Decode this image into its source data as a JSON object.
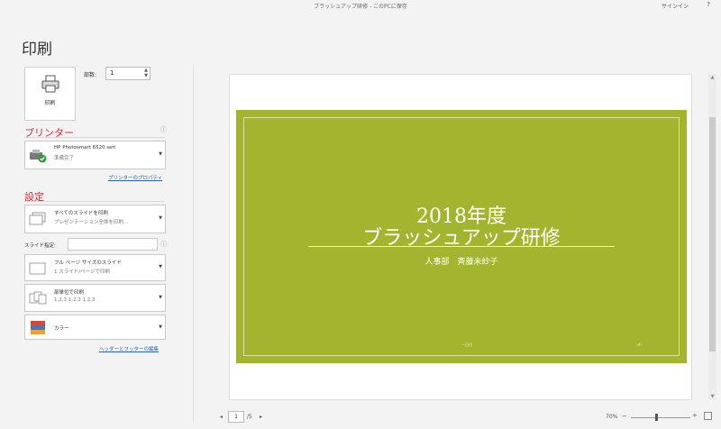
{
  "titlebar": {
    "doc_title": "ブラッシュアップ研修 - このPCに保存",
    "signin": "サインイン",
    "help": "?"
  },
  "page_title": "印刷",
  "print_button": {
    "label": "印刷"
  },
  "copies": {
    "label": "部数:",
    "value": "1"
  },
  "printer": {
    "section_label": "プリンター",
    "name": "HP Photosmart 6520 seri",
    "status": "準備完了",
    "properties_link": "プリンターのプロパティ"
  },
  "settings": {
    "section_label": "設定",
    "slides_option": {
      "line1": "すべてのスライドを印刷",
      "line2": "プレゼンテーション全体を印刷..."
    },
    "slides_field_label": "スライド指定:",
    "layout_option": {
      "line1": "フル ページ サイズのスライド",
      "line2": "1 スライド/ページで印刷"
    },
    "collate_option": {
      "line1": "部単位で印刷",
      "line2": "1,2,3   1,2,3   1,2,3"
    },
    "color_option": {
      "line1": "カラー"
    },
    "header_footer_link": "ヘッダーとフッターの編集"
  },
  "slide": {
    "title_line1": "2018年度",
    "title_line2": "ブラッシュアップ研修",
    "subtitle": "人事部　斉藤未紗子",
    "date_text": "ー日付",
    "number_text": "‹#›"
  },
  "pager": {
    "prev": "◂",
    "current": "1",
    "total": "/5",
    "next": "▸"
  },
  "zoom": {
    "value": "70%",
    "minus": "−",
    "plus": "+"
  },
  "colors": {
    "slide_background": "#a3b52f",
    "section_heading": "#cc3333",
    "link": "#2a64b0"
  }
}
